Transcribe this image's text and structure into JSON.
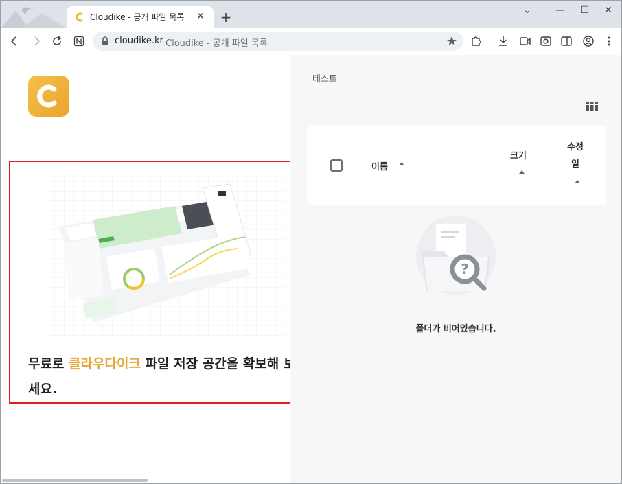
{
  "browser": {
    "tab": {
      "title": "Cloudike - 공개 파일 목록",
      "close_glyph": "✕"
    },
    "new_tab_glyph": "+",
    "window_controls": {
      "tabs_menu": "⌄",
      "minimize": "—",
      "maximize": "☐",
      "close": "✕"
    },
    "omnibox": {
      "domain": "cloudike.kr",
      "page_title": "Cloudike - 공개 파일 목록"
    }
  },
  "left": {
    "promo": {
      "text_before": "무료로 ",
      "text_accent": "클라우다이크",
      "text_after": " 파일 저장 공간을 확보해 보세요."
    }
  },
  "right": {
    "breadcrumb": "테스트",
    "table": {
      "columns": {
        "name": "이름",
        "size": "크기",
        "modified": "수정일"
      }
    },
    "empty_message": "폴더가 비어있습니다."
  },
  "colors": {
    "accent": "#e6a73a",
    "logo": "#f0b53a",
    "highlight_border": "#e02020"
  }
}
